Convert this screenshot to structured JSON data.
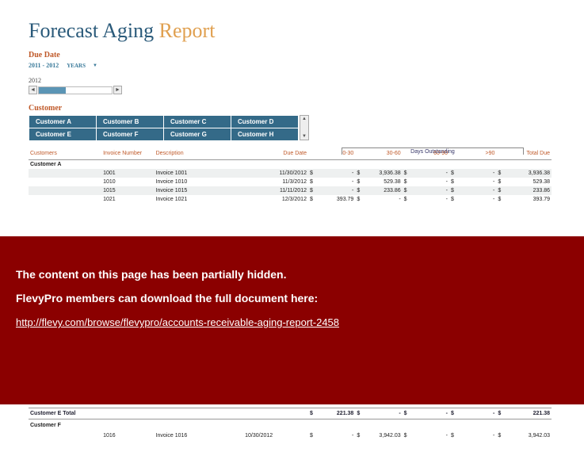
{
  "title": {
    "part1": "Forecast Aging ",
    "part2": "Report"
  },
  "due_date": {
    "label": "Due Date",
    "range": "2011 - 2012",
    "years_btn": "YEARS",
    "slider_year": "2012"
  },
  "customer": {
    "label": "Customer",
    "grid": [
      [
        "Customer A",
        "Customer B",
        "Customer C",
        "Customer D"
      ],
      [
        "Customer E",
        "Customer F",
        "Customer G",
        "Customer H"
      ]
    ]
  },
  "days_outstanding_label": "Days Outstanding",
  "headers": {
    "customers": "Customers",
    "invoice_number": "Invoice Number",
    "description": "Description",
    "due_date": "Due Date",
    "b0_30": "0-30",
    "b30_60": "30-60",
    "b60_90": "60-90",
    "b90p": ">90",
    "total_due": "Total Due"
  },
  "groupA": {
    "name": "Customer A",
    "rows": [
      {
        "inv": "1001",
        "desc": "Invoice 1001",
        "due": "11/30/2012",
        "a": "-",
        "b": "3,936.38",
        "c": "-",
        "d": "-",
        "tot": "3,936.38"
      },
      {
        "inv": "1010",
        "desc": "Invoice 1010",
        "due": "11/3/2012",
        "a": "-",
        "b": "529.38",
        "c": "-",
        "d": "-",
        "tot": "529.38"
      },
      {
        "inv": "1015",
        "desc": "Invoice 1015",
        "due": "11/11/2012",
        "a": "-",
        "b": "233.86",
        "c": "-",
        "d": "-",
        "tot": "233.86"
      },
      {
        "inv": "1021",
        "desc": "Invoice 1021",
        "due": "12/3/2012",
        "a": "393.79",
        "b": "-",
        "c": "-",
        "d": "-",
        "tot": "393.79"
      }
    ]
  },
  "groupE_total": {
    "name": "Customer E Total",
    "a": "221.38",
    "b": "-",
    "c": "-",
    "d": "-",
    "tot": "221.38"
  },
  "groupF": {
    "name": "Customer F",
    "row": {
      "inv": "1016",
      "desc": "Invoice 1016",
      "due": "10/30/2012",
      "a": "-",
      "b": "3,942.03",
      "c": "-",
      "d": "-",
      "tot": "3,942.03"
    }
  },
  "currency": "$",
  "overlay": {
    "line1": "The content on this page has been partially hidden.",
    "line2": "FlevyPro members can download the full document here:",
    "link": "http://flevy.com/browse/flevypro/accounts-receivable-aging-report-2458"
  }
}
